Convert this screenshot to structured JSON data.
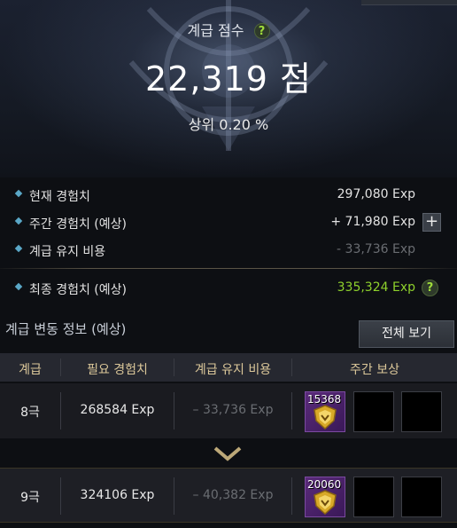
{
  "hero": {
    "title": "계급 점수",
    "help": "?",
    "score": "22,319 점",
    "rank": "상위 0.20 %"
  },
  "info": [
    {
      "label": "현재 경험치",
      "value": "297,080 Exp",
      "style": "normal"
    },
    {
      "label": "주간 경험치 (예상)",
      "value": "+ 71,980 Exp",
      "style": "normal",
      "button": "+"
    },
    {
      "label": "계급 유지 비용",
      "value": "- 33,736 Exp",
      "style": "dim"
    },
    {
      "label": "최종 경험치 (예상)",
      "value": "335,324 Exp",
      "style": "green",
      "help": "?"
    }
  ],
  "section": {
    "title": "계급 변동 정보 (예상)",
    "view_all": "전체 보기"
  },
  "table": {
    "headers": [
      "계급",
      "필요 경험치",
      "계급 유지 비용",
      "주간 보상"
    ],
    "rows": [
      {
        "rank": "8극",
        "required": "268584 Exp",
        "upkeep": "– 33,736 Exp",
        "reward_count": "15368"
      },
      {
        "rank": "9극",
        "required": "324106 Exp",
        "upkeep": "– 40,382 Exp",
        "reward_count": "20060"
      }
    ]
  },
  "colors": {
    "accent_green": "#8ed12c",
    "header_gold": "#dcc89a",
    "bullet_blue": "#5aa7c7"
  }
}
